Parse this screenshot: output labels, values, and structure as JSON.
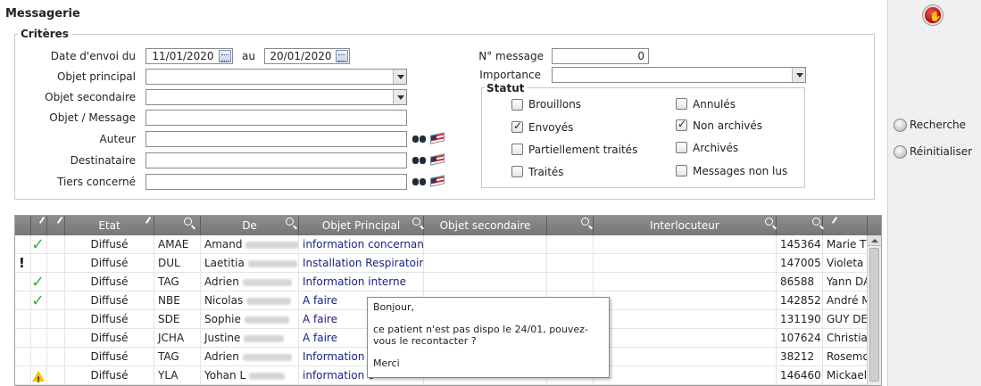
{
  "app": {
    "title": "Messagerie"
  },
  "criteria": {
    "legend": "Critères",
    "date_label": "Date d'envoi du",
    "date_from": "11/01/2020",
    "au_label": "au",
    "date_to": "20/01/2020",
    "objet_principal_label": "Objet principal",
    "objet_secondaire_label": "Objet secondaire",
    "objet_message_label": "Objet / Message",
    "auteur_label": "Auteur",
    "destinataire_label": "Destinataire",
    "tiers_label": "Tiers concerné",
    "num_message_label": "N° message",
    "num_message_value": "0",
    "importance_label": "Importance",
    "statut": {
      "legend": "Statut",
      "brouillons": "Brouillons",
      "envoyes": "Envoyés",
      "partiellement": "Partiellement traités",
      "traites": "Traités",
      "annules": "Annulés",
      "non_archives": "Non archivés",
      "archives": "Archivés",
      "non_lus": "Messages non lus"
    }
  },
  "actions": {
    "recherche": "Recherche",
    "reinitialiser": "Réinitialiser"
  },
  "grid": {
    "headers": {
      "etat": "Etat",
      "de": "De",
      "objet_principal": "Objet Principal",
      "objet_secondaire": "Objet secondaire",
      "interlocuteur": "Interlocuteur"
    },
    "rows": [
      {
        "icon": "check",
        "etat": "Diffusé",
        "code": "AMAE",
        "de": "Amand",
        "objet": "information concernant",
        "num": "145364",
        "tiers": "Marie Th"
      },
      {
        "icon": "exclamation",
        "etat": "Diffusé",
        "code": "DUL",
        "de": "Laetitia",
        "objet": "Installation Respiratoire",
        "num": "147005",
        "tiers": "Violeta R"
      },
      {
        "icon": "check",
        "etat": "Diffusé",
        "code": "TAG",
        "de": "Adrien",
        "objet": "Information interne",
        "num": "86588",
        "tiers": "Yann DA"
      },
      {
        "icon": "check",
        "etat": "Diffusé",
        "code": "NBE",
        "de": "Nicolas",
        "objet": "A faire",
        "num": "142852",
        "tiers": "André M"
      },
      {
        "icon": "",
        "etat": "Diffusé",
        "code": "SDE",
        "de": "Sophie",
        "objet": "A faire",
        "num": "131190",
        "tiers": "GUY DEL"
      },
      {
        "icon": "",
        "etat": "Diffusé",
        "code": "JCHA",
        "de": "Justine",
        "objet": "A faire",
        "num": "107624",
        "tiers": "Christian"
      },
      {
        "icon": "",
        "etat": "Diffusé",
        "code": "TAG",
        "de": "Adrien",
        "objet": "Information i",
        "num": "38212",
        "tiers": "Rosemor"
      },
      {
        "icon": "warning",
        "etat": "Diffusé",
        "code": "YLA",
        "de": "Yohan L",
        "objet": "information c",
        "num": "146460",
        "tiers": "Mickael F"
      }
    ]
  },
  "tooltip": {
    "line1": "Bonjour,",
    "line2": "ce patient n'est pas dispo le 24/01, pouvez-vous le recontacter ?",
    "line3": "Merci"
  }
}
